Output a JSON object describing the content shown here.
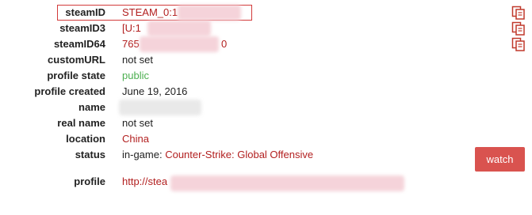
{
  "profile": {
    "rows": [
      {
        "label": "steamID",
        "value": "STEAM_0:1"
      },
      {
        "label": "steamID3",
        "value": "[U:1"
      },
      {
        "label": "steamID64",
        "value": "765"
      },
      {
        "label": "customURL",
        "value": "not set"
      },
      {
        "label": "profile state",
        "value": "public"
      },
      {
        "label": "profile created",
        "value": "June 19, 2016"
      },
      {
        "label": "name",
        "value": ""
      },
      {
        "label": "real name",
        "value": "not set"
      },
      {
        "label": "location",
        "value": "China"
      },
      {
        "label": "status",
        "value_prefix": "in-game:",
        "value_game": "Counter-Strike: Global Offensive"
      },
      {
        "label": "profile",
        "value": "http://stea"
      }
    ],
    "steamid64_tail": "0",
    "watch_label": "watch"
  },
  "icons": {
    "copy": "copy-icon"
  },
  "colors": {
    "accent": "#d9534f",
    "link_red": "#b21f1f",
    "public_green": "#4caf50",
    "highlight_border": "#d23a3a"
  }
}
